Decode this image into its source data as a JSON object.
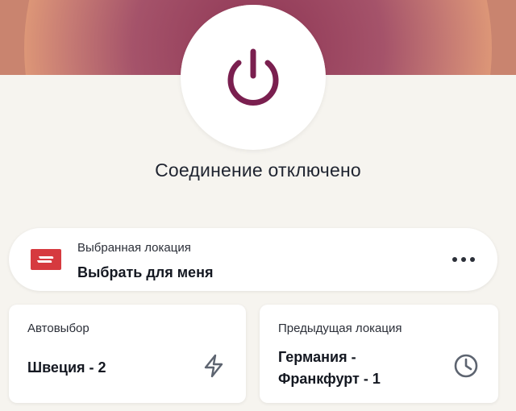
{
  "connection": {
    "status": "Соединение отключено",
    "power_icon": "power-icon",
    "accent_color": "#7a1f4f"
  },
  "selected_location": {
    "label": "Выбранная локация",
    "value": "Выбрать для меня",
    "flag_icon": "expressvpn-logo-flag",
    "more_icon": "more-horizontal-icon"
  },
  "smart_location": {
    "label": "Автовыбор",
    "value": "Швеция - 2",
    "icon": "lightning-icon"
  },
  "recent_location": {
    "label": "Предыдущая локация",
    "value": "Германия - Франкфурт - 1",
    "icon": "clock-icon"
  }
}
